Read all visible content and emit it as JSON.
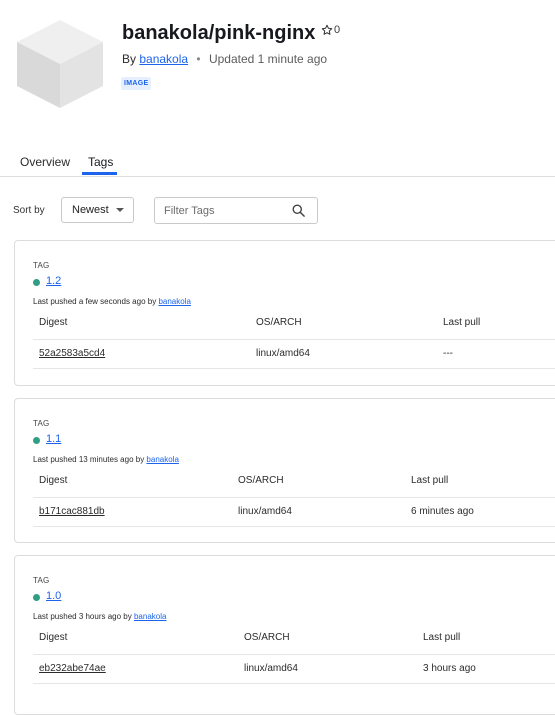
{
  "repo": {
    "title": "banakola/pink-nginx",
    "stars": "0",
    "by_label": "By",
    "owner": "banakola",
    "updated": "Updated 1 minute ago",
    "badge": "IMAGE"
  },
  "tabs": [
    {
      "label": "Overview",
      "active": false
    },
    {
      "label": "Tags",
      "active": true
    }
  ],
  "controls": {
    "sort_label": "Sort by",
    "sort_value": "Newest",
    "filter_placeholder": "Filter Tags"
  },
  "table_headers": {
    "digest": "Digest",
    "os_arch": "OS/ARCH",
    "last_pull": "Last pull"
  },
  "tags": [
    {
      "label": "TAG",
      "name": "1.2",
      "pushed_prefix": "Last pushed a few seconds ago by",
      "pushed_by": "banakola",
      "digest": "52a2583a5cd4",
      "os_arch": "linux/amd64",
      "last_pull": "---"
    },
    {
      "label": "TAG",
      "name": "1.1",
      "pushed_prefix": "Last pushed 13 minutes ago by",
      "pushed_by": "banakola",
      "digest": "b171cac881db",
      "os_arch": "linux/amd64",
      "last_pull": "6 minutes ago"
    },
    {
      "label": "TAG",
      "name": "1.0",
      "pushed_prefix": "Last pushed 3 hours ago by",
      "pushed_by": "banakola",
      "digest": "eb232abe74ae",
      "os_arch": "linux/amd64",
      "last_pull": "3 hours ago"
    }
  ],
  "colors": {
    "link": "#1d63ed",
    "status_active": "#2f9e84",
    "badge_bg": "#e6effd"
  },
  "icons": {
    "repo": "image-cube-icon",
    "star": "star-outline-icon",
    "sort": "chevron-down-icon",
    "filter": "search-icon"
  }
}
